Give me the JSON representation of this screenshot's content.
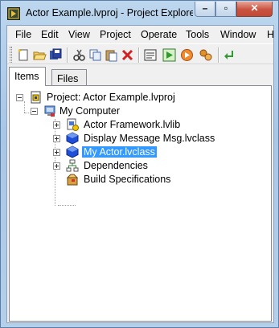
{
  "window": {
    "title": "Actor Example.lvproj - Project Explorer",
    "minimize_glyph": "–",
    "maximize_glyph": "▫",
    "close_glyph": "✕"
  },
  "menubar": {
    "items": [
      "File",
      "Edit",
      "View",
      "Project",
      "Operate",
      "Tools",
      "Window",
      "H"
    ]
  },
  "toolbar": {
    "buttons": [
      "new-icon",
      "open-icon",
      "save-all-icon",
      "cut-icon",
      "copy-icon",
      "paste-icon",
      "delete-icon",
      "properties-icon",
      "run-icon",
      "build-icon",
      "deploy-icon",
      "arrow-icon"
    ]
  },
  "tabs": {
    "items": {
      "label": "Items"
    },
    "files": {
      "label": "Files"
    }
  },
  "tree": {
    "project": {
      "label": "Project: Actor Example.lvproj"
    },
    "computer": {
      "label": "My Computer"
    },
    "children": [
      {
        "label": "Actor Framework.lvlib",
        "icon": "library-icon"
      },
      {
        "label": "Display Message Msg.lvclass",
        "icon": "class-icon"
      },
      {
        "label": "My Actor.lvclass",
        "icon": "class-icon",
        "selected": true
      },
      {
        "label": "Dependencies",
        "icon": "dependencies-icon"
      },
      {
        "label": "Build Specifications",
        "icon": "build-specifications-icon"
      }
    ]
  },
  "colors": {
    "selection": "#3399ff",
    "title_bar": "#b4cfe9",
    "close_button": "#c9533f"
  }
}
